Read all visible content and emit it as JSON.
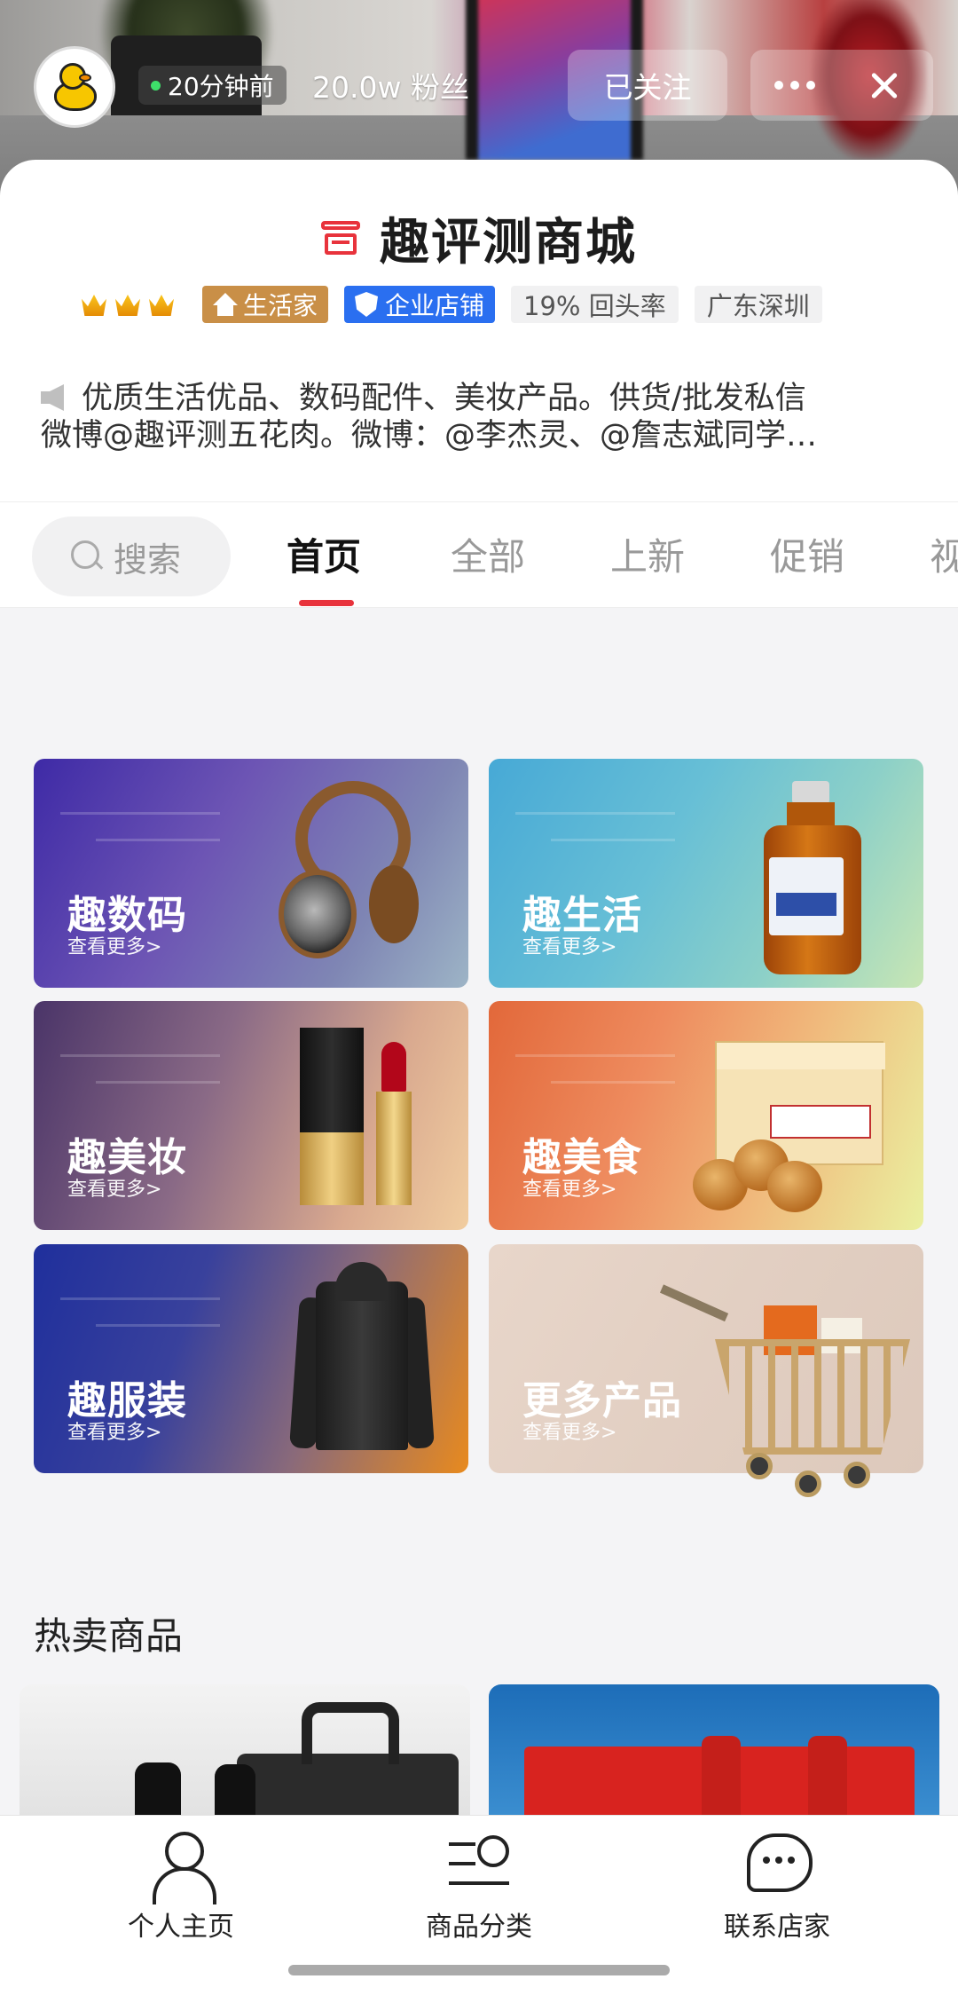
{
  "header": {
    "online_time": "20分钟前",
    "fans": "20.0w 粉丝",
    "follow_label": "已关注"
  },
  "store": {
    "name": "趣评测商城",
    "badges": {
      "life": "生活家",
      "corp": "企业店铺",
      "return_rate": "19% 回头率",
      "location": "广东深圳"
    },
    "notice_line1": "优质生活优品、数码配件、美妆产品。供货/批发私信",
    "notice_line2": "微博@趣评测五花肉。微博：@李杰灵、@詹志斌同学…"
  },
  "tabs": {
    "search_label": "搜索",
    "items": [
      "首页",
      "全部",
      "上新",
      "促销",
      "视"
    ]
  },
  "categories": [
    {
      "title": "趣数码",
      "sub": "查看更多>"
    },
    {
      "title": "趣生活",
      "sub": "查看更多>"
    },
    {
      "title": "趣美妆",
      "sub": "查看更多>"
    },
    {
      "title": "趣美食",
      "sub": "查看更多>"
    },
    {
      "title": "趣服装",
      "sub": "查看更多>"
    },
    {
      "title": "更多产品",
      "sub": "查看更多>"
    }
  ],
  "hot": {
    "title": "热卖商品"
  },
  "bottom_nav": {
    "profile": "个人主页",
    "category": "商品分类",
    "contact": "联系店家"
  },
  "colors": {
    "accent": "#e8333c",
    "corp_badge": "#2a6ff0",
    "life_badge": "#c98f47"
  }
}
